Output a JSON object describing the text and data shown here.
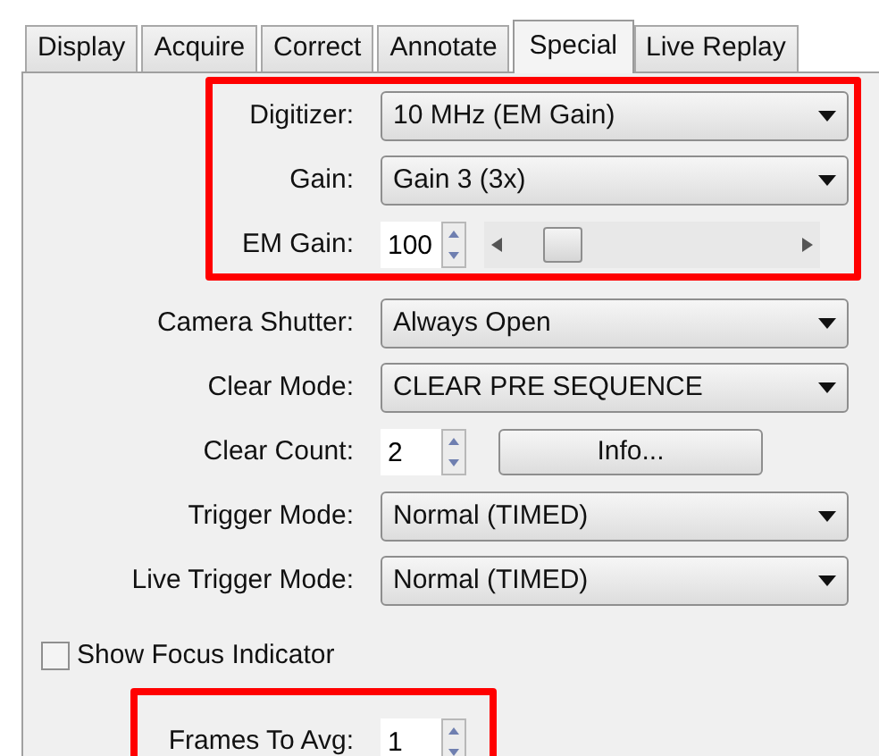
{
  "tabs": [
    {
      "label": "Display",
      "selected": false
    },
    {
      "label": "Acquire",
      "selected": false
    },
    {
      "label": "Correct",
      "selected": false
    },
    {
      "label": "Annotate",
      "selected": false
    },
    {
      "label": "Special",
      "selected": true
    },
    {
      "label": "Live Replay",
      "selected": false
    }
  ],
  "sections": [
    {
      "highlighted": true,
      "rows": [
        {
          "kind": "dropdown",
          "label": "Digitizer:",
          "value": "10 MHz (EM Gain)"
        },
        {
          "kind": "dropdown",
          "label": "Gain:",
          "value": "Gain 3 (3x)"
        },
        {
          "kind": "spin_slider",
          "label": "EM Gain:",
          "value": "100",
          "level": 0.2
        }
      ]
    },
    {
      "highlighted": false,
      "rows": [
        {
          "kind": "dropdown",
          "label": "Camera Shutter:",
          "value": "Always Open"
        },
        {
          "kind": "dropdown",
          "label": "Clear Mode:",
          "value": "CLEAR PRE SEQUENCE"
        },
        {
          "kind": "spin_button",
          "label": "Clear Count:",
          "value": "2",
          "button": "Info..."
        },
        {
          "kind": "dropdown",
          "label": "Trigger Mode:",
          "value": "Normal (TIMED)"
        },
        {
          "kind": "dropdown",
          "label": "Live Trigger Mode:",
          "value": "Normal (TIMED)"
        }
      ]
    },
    {
      "highlighted": false,
      "rows": [
        {
          "kind": "checkbox",
          "label": "Show Focus Indicator",
          "checked": false
        }
      ]
    },
    {
      "highlighted": true,
      "rows": [
        {
          "kind": "spin",
          "label": "Frames To Avg:",
          "value": "1"
        }
      ]
    }
  ]
}
